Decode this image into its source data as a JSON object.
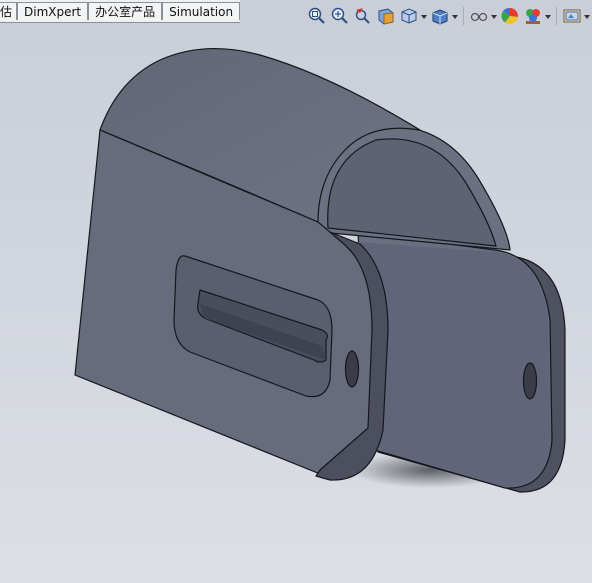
{
  "tabs": [
    {
      "label": "估"
    },
    {
      "label": "DimXpert"
    },
    {
      "label": "办公室产品"
    },
    {
      "label": "Simulation"
    }
  ],
  "heads_up_toolbar": [
    {
      "icon": "zoom-to-fit-icon"
    },
    {
      "icon": "zoom-to-area-icon"
    },
    {
      "icon": "previous-view-icon"
    },
    {
      "icon": "section-view-icon"
    },
    {
      "icon": "view-orientation-icon"
    },
    {
      "icon": "display-style-icon"
    },
    {
      "icon": "hide-show-items-icon"
    },
    {
      "icon": "edit-appearance-icon"
    },
    {
      "icon": "apply-scene-icon"
    },
    {
      "icon": "view-settings-icon"
    }
  ],
  "colors": {
    "model_face": "#666b7c",
    "model_face_light": "#7b8090",
    "model_face_dark": "#555a69",
    "model_edge": "#15171d",
    "background_top": "#c9ced8",
    "background_bottom": "#dcdfe5"
  }
}
